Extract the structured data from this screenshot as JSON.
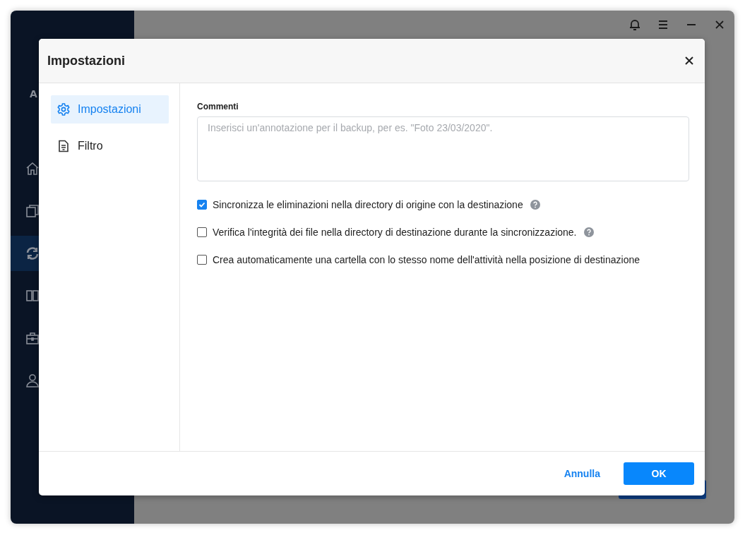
{
  "app": {
    "logo_text": "A",
    "sidebar_items": [
      {
        "kind": "home",
        "selected": false
      },
      {
        "kind": "copy",
        "selected": false
      },
      {
        "kind": "sync",
        "selected": true
      },
      {
        "kind": "columns",
        "selected": false
      },
      {
        "kind": "toolbox",
        "selected": false
      },
      {
        "kind": "user",
        "selected": false
      }
    ]
  },
  "dialog": {
    "title": "Impostazioni",
    "nav": [
      {
        "kind": "settings",
        "label": "Impostazioni",
        "selected": true
      },
      {
        "kind": "filter",
        "label": "Filtro",
        "selected": false
      }
    ],
    "comments": {
      "label": "Commenti",
      "placeholder": "Inserisci un'annotazione per il backup, per es. \"Foto 23/03/2020\"."
    },
    "options": [
      {
        "label": "Sincronizza le eliminazioni nella directory di origine con la destinazione",
        "checked": true,
        "help": true
      },
      {
        "label": "Verifica l'integrità dei file nella directory di destinazione durante la sincronizzazione.",
        "checked": false,
        "help": true
      },
      {
        "label": "Crea automaticamente una cartella con lo stesso nome dell'attività nella posizione di destinazione",
        "checked": false,
        "help": false
      }
    ],
    "buttons": {
      "cancel": "Annulla",
      "ok": "OK"
    }
  }
}
